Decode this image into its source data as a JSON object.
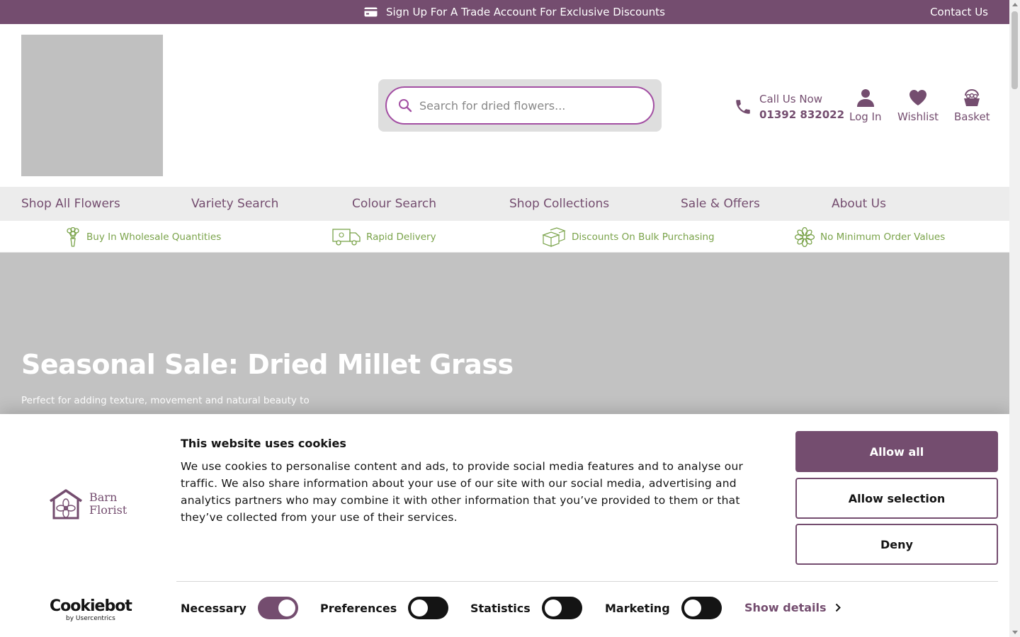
{
  "topbar": {
    "promo": "Sign Up For A Trade Account For Exclusive Discounts",
    "contact": "Contact Us"
  },
  "header": {
    "search_placeholder": "Search for dried flowers...",
    "call_label": "Call Us Now",
    "phone": "01392 832022",
    "login": "Log In",
    "wishlist": "Wishlist",
    "basket": "Basket"
  },
  "nav": {
    "items": [
      "Shop All Flowers",
      "Variety Search",
      "Colour Search",
      "Shop Collections",
      "Sale & Offers",
      "About Us"
    ]
  },
  "usps": [
    "Buy In Wholesale Quantities",
    "Rapid Delivery",
    "Discounts On Bulk Purchasing",
    "No Minimum Order Values"
  ],
  "hero": {
    "title": "Seasonal Sale: Dried Millet Grass",
    "subtitle": "Perfect for adding texture, movement and natural beauty to"
  },
  "cookie": {
    "brand_line1": "Barn",
    "brand_line2": "Florist",
    "title": "This website uses cookies",
    "body": "We use cookies to personalise content and ads, to provide social media features and to analyse our traffic. We also share information about your use of our site with our social media, advertising and analytics partners who may combine it with other information that you’ve provided to them or that they’ve collected from your use of their services.",
    "allow_all": "Allow all",
    "allow_selection": "Allow selection",
    "deny": "Deny",
    "cookiebot_line1": "Cookiebot",
    "cookiebot_line2": "by Usercentrics",
    "toggles": [
      {
        "label": "Necessary",
        "on": true
      },
      {
        "label": "Preferences",
        "on": false
      },
      {
        "label": "Statistics",
        "on": false
      },
      {
        "label": "Marketing",
        "on": false
      }
    ],
    "show_details": "Show details"
  },
  "colors": {
    "brand": "#744d6f",
    "accent_green": "#7aa34a",
    "search_border": "#a34fa3"
  },
  "icons": [
    "card-icon",
    "search-icon",
    "phone-icon",
    "user-icon",
    "heart-icon",
    "basket-icon",
    "bouquet-icon",
    "delivery-van-icon",
    "boxes-icon",
    "flower-icon",
    "chevron-right-icon"
  ]
}
